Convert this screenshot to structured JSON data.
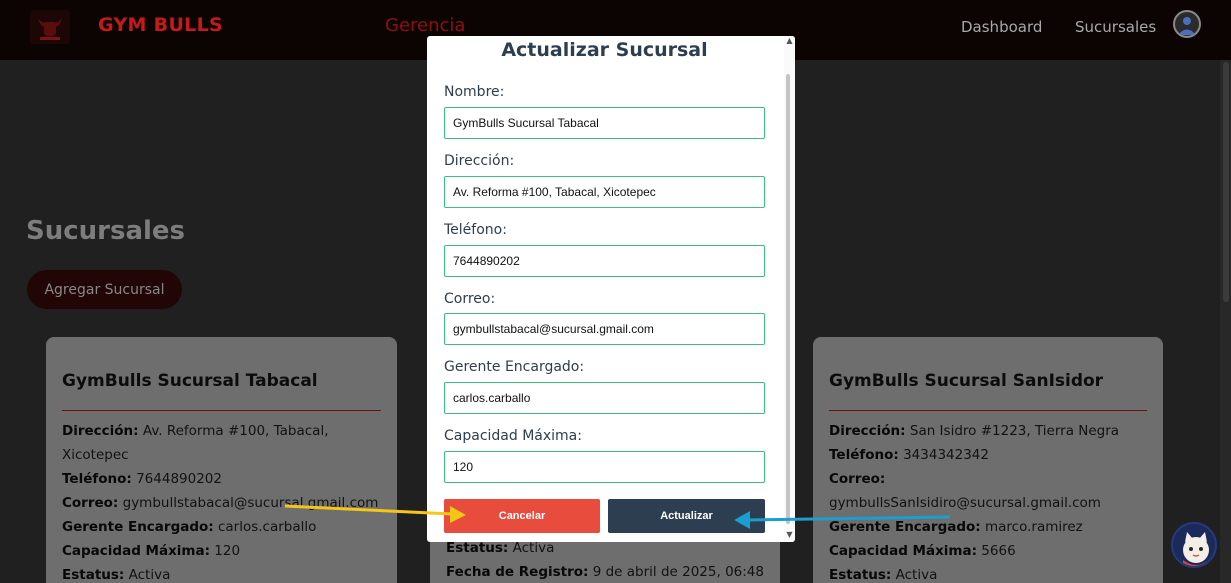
{
  "navbar": {
    "brand": "GYM BULLS",
    "section_title": "Gerencia",
    "links": [
      "Dashboard",
      "Sucursales"
    ]
  },
  "page": {
    "title": "Sucursales",
    "add_button": "Agregar Sucursal"
  },
  "cards": [
    {
      "name": "GymBulls Sucursal Tabacal",
      "direccion_label": "Dirección:",
      "direccion_value": " Av. Reforma #100, Tabacal,",
      "direccion_value_2": "Xicotepec",
      "telefono_label": "Teléfono:",
      "telefono_value": " 7644890202",
      "correo_label": "Correo:",
      "correo_value": " gymbullstabacal@sucursal.gmail.com",
      "gerente_label": "Gerente Encargado:",
      "gerente_value": " carlos.carballo",
      "capacidad_label": "Capacidad Máxima:",
      "capacidad_value": " 120",
      "estatus_label": "Estatus:",
      "estatus_value": " Activa"
    },
    {
      "estatus_label": "Estatus:",
      "estatus_value": " Activa",
      "fecha_label": "Fecha de Registro:",
      "fecha_value": " 9 de abril de 2025, 06:48"
    },
    {
      "name": "GymBulls Sucursal SanIsidor",
      "direccion_label": "Dirección:",
      "direccion_value": " San Isidro #1223, Tierra Negra",
      "telefono_label": "Teléfono:",
      "telefono_value": " 3434342342",
      "correo_label": "Correo:",
      "correo_value": "gymbullsSanIsidiro@sucursal.gmail.com",
      "gerente_label": "Gerente Encargado:",
      "gerente_value": " marco.ramirez",
      "capacidad_label": "Capacidad Máxima:",
      "capacidad_value": " 5666",
      "estatus_label": "Estatus:",
      "estatus_value": " Activa"
    }
  ],
  "modal": {
    "title": "Actualizar Sucursal",
    "fields": [
      {
        "label": "Nombre:",
        "value": "GymBulls Sucursal Tabacal"
      },
      {
        "label": "Dirección:",
        "value": "Av. Reforma #100, Tabacal, Xicotepec"
      },
      {
        "label": "Teléfono:",
        "value": "7644890202"
      },
      {
        "label": "Correo:",
        "value": "gymbullstabacal@sucursal.gmail.com"
      },
      {
        "label": "Gerente Encargado:",
        "value": "carlos.carballo"
      },
      {
        "label": "Capacidad Máxima:",
        "value": "120"
      }
    ],
    "cancel_label": "Cancelar",
    "update_label": "Actualizar"
  },
  "colors": {
    "brand": "#c41a1a",
    "modal_title": "#2c3e50",
    "input_border": "#3bbf7f",
    "cancel": "#e74c3c",
    "update": "#2c3e50",
    "arrow_yellow": "#f5c518",
    "arrow_blue": "#1a9fd0"
  },
  "icons": {
    "logo": "bull-logo-icon",
    "user": "user-avatar-icon",
    "mascot": "cat-mascot-icon",
    "scroll_up": "chevron-up-icon",
    "scroll_down": "chevron-down-icon"
  }
}
